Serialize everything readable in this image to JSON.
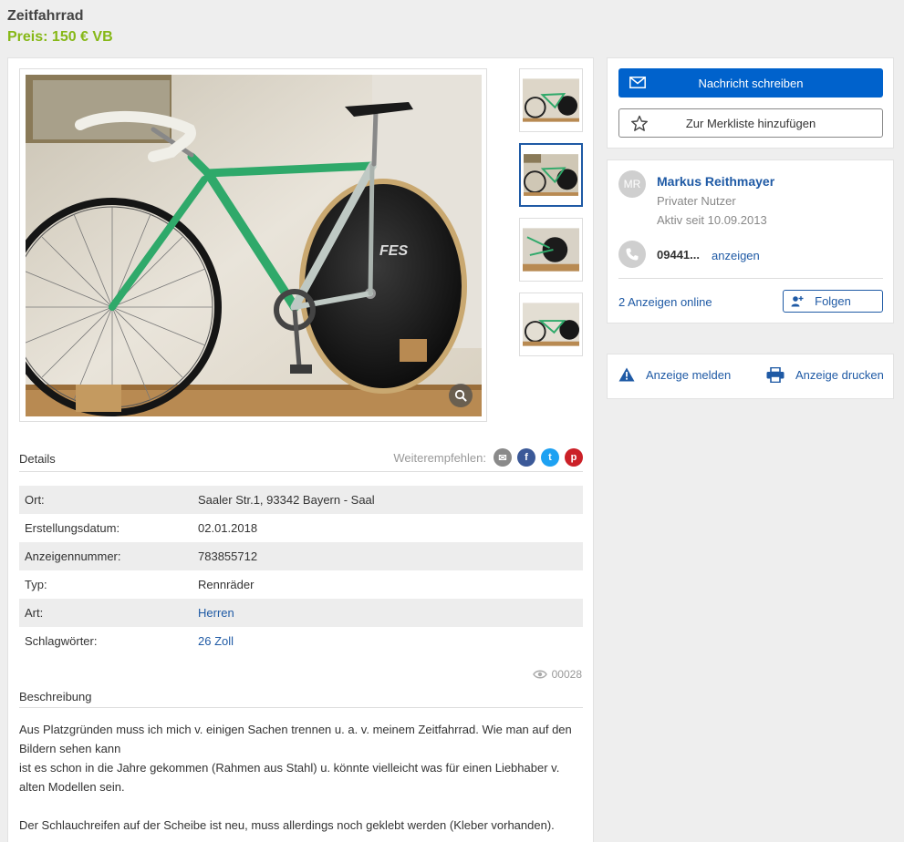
{
  "ad": {
    "title": "Zeitfahrrad",
    "price": "Preis: 150 € VB"
  },
  "share": {
    "label": "Weiterempfehlen:",
    "email_glyph": "✉",
    "facebook_glyph": "f",
    "twitter_glyph": "t",
    "pinterest_glyph": "p"
  },
  "details": {
    "heading": "Details",
    "rows": [
      {
        "key": "Ort:",
        "value": "Saaler Str.1, 93342 Bayern - Saal"
      },
      {
        "key": "Erstellungsdatum:",
        "value": "02.01.2018"
      },
      {
        "key": "Anzeigennummer:",
        "value": "783855712"
      },
      {
        "key": "Typ:",
        "value": "Rennräder"
      },
      {
        "key": "Art:",
        "value": "Herren"
      },
      {
        "key": "Schlagwörter:",
        "value": "26 Zoll"
      }
    ]
  },
  "views": "00028",
  "description": {
    "heading": "Beschreibung",
    "paragraphs": [
      "Aus Platzgründen muss ich mich v. einigen Sachen trennen u. a. v. meinem Zeitfahrrad. Wie man auf den Bildern sehen kann",
      "ist es schon in die Jahre gekommen (Rahmen aus Stahl) u. könnte vielleicht was für einen Liebhaber v. alten Modellen sein.",
      "",
      "Der Schlauchreifen auf der Scheibe ist neu, muss allerdings noch geklebt werden (Kleber vorhanden)."
    ]
  },
  "actions": {
    "message": "Nachricht schreiben",
    "watchlist": "Zur Merkliste hinzufügen"
  },
  "seller": {
    "initials": "MR",
    "name": "Markus Reithmayer",
    "type": "Privater Nutzer",
    "active_since": "Aktiv seit 10.09.2013",
    "phone": "09441...",
    "phone_show": "anzeigen",
    "ads_online": "2 Anzeigen online",
    "follow": "Folgen"
  },
  "report": {
    "report_label": "Anzeige melden",
    "print_label": "Anzeige drucken"
  },
  "colors": {
    "accent": "#0062cc",
    "link": "#1f5aa5",
    "price": "#86b817",
    "email": "#8a8a8a",
    "facebook": "#3b5998",
    "twitter": "#1da1f2",
    "pinterest": "#cb2027"
  },
  "icons": [
    "mail-icon",
    "star-icon",
    "phone-icon",
    "follow-user-icon",
    "warning-icon",
    "printer-icon",
    "zoom-icon",
    "eye-icon"
  ]
}
